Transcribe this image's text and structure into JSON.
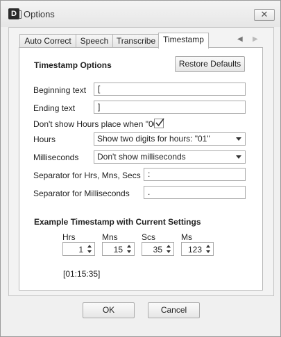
{
  "window": {
    "title": "Options",
    "app_icon_letter": "D",
    "close_glyph": "✕"
  },
  "tabs": [
    {
      "label": "Auto Correct",
      "active": false
    },
    {
      "label": "Speech",
      "active": false
    },
    {
      "label": "Transcribe",
      "active": false
    },
    {
      "label": "Timestamp",
      "active": true
    }
  ],
  "tab_scroll": {
    "left": "◀",
    "right": "▶"
  },
  "timestamp_options": {
    "heading": "Timestamp Options",
    "restore_defaults_label": "Restore Defaults",
    "beginning_text_label": "Beginning text",
    "beginning_text_value": "[",
    "ending_text_label": "Ending text",
    "ending_text_value": "]",
    "dont_show_hours_label": "Don't show Hours place when \"00\"",
    "dont_show_hours_checked": true,
    "hours_label": "Hours",
    "hours_selected": "Show two digits for hours: \"01\"",
    "milliseconds_label": "Milliseconds",
    "milliseconds_selected": "Don't show milliseconds",
    "sep_hms_label": "Separator for Hrs, Mns, Secs",
    "sep_hms_value": ":",
    "sep_ms_label": "Separator for Milliseconds",
    "sep_ms_value": "."
  },
  "example": {
    "heading": "Example Timestamp with Current Settings",
    "hrs_label": "Hrs",
    "hrs_value": "1",
    "mns_label": "Mns",
    "mns_value": "15",
    "scs_label": "Scs",
    "scs_value": "35",
    "ms_label": "Ms",
    "ms_value": "123",
    "result": "[01:15:35]"
  },
  "footer": {
    "ok_label": "OK",
    "cancel_label": "Cancel"
  }
}
